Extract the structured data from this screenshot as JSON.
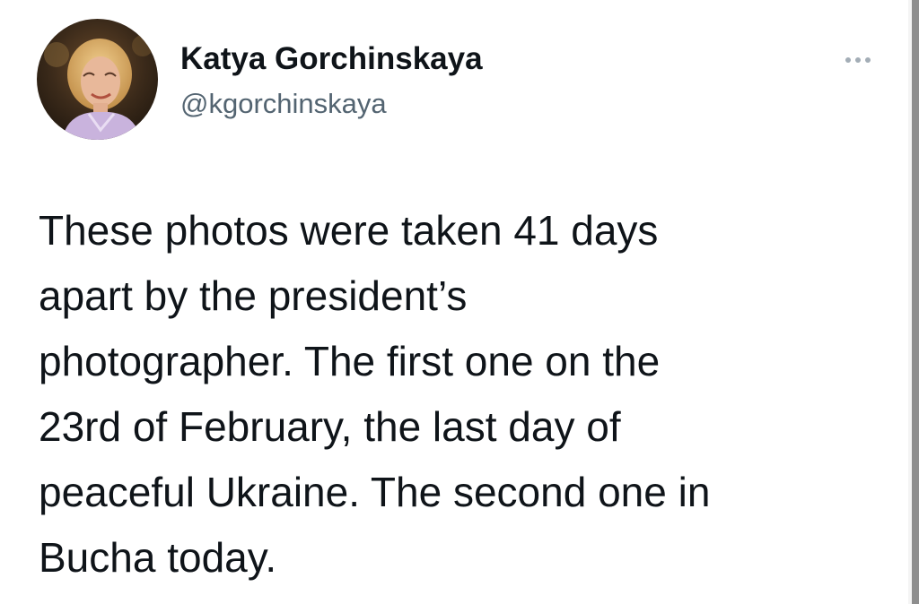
{
  "author": {
    "display_name": "Katya Gorchinskaya",
    "handle": "@kgorchinskaya",
    "avatar_icon": "user-avatar-photo"
  },
  "menu": {
    "icon": "more-horizontal-icon"
  },
  "tweet": {
    "lines": [
      "These photos were taken 41 days",
      "apart by the president’s",
      "photographer. The first one on the",
      "23rd of February, the last day of",
      "peaceful Ukraine. The second one in",
      "Bucha today."
    ]
  },
  "colors": {
    "text_primary": "#0f1419",
    "text_secondary": "#536471",
    "menu_dots": "#a3adb6"
  }
}
